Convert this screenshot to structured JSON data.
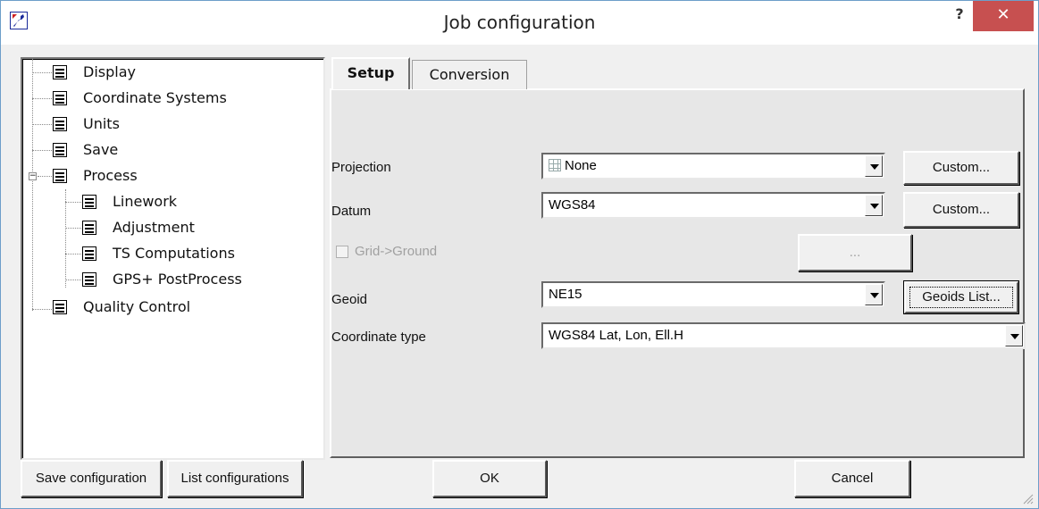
{
  "window": {
    "title": "Job configuration",
    "help_label": "?",
    "close_label": "✕",
    "app_icon": "wrench-icon"
  },
  "tree": {
    "items": [
      {
        "label": "Display"
      },
      {
        "label": "Coordinate Systems"
      },
      {
        "label": "Units"
      },
      {
        "label": "Save"
      },
      {
        "label": "Process",
        "expanded": true
      },
      {
        "label": "Linework"
      },
      {
        "label": "Adjustment"
      },
      {
        "label": "TS Computations"
      },
      {
        "label": "GPS+ PostProcess"
      },
      {
        "label": "Quality Control"
      }
    ],
    "expander_symbol": "−"
  },
  "tabs": [
    {
      "label": "Setup",
      "active": true
    },
    {
      "label": "Conversion",
      "active": false
    }
  ],
  "setup": {
    "projection": {
      "label": "Projection",
      "value": "None",
      "icon": "grid-icon",
      "button": "Custom..."
    },
    "datum": {
      "label": "Datum",
      "value": "WGS84",
      "button": "Custom..."
    },
    "grid_ground": {
      "label": "Grid->Ground",
      "checked": false,
      "enabled": false,
      "button": "..."
    },
    "geoid": {
      "label": "Geoid",
      "value": "NE15",
      "button": "Geoids List..."
    },
    "coordinate_type": {
      "label": "Coordinate type",
      "value": "WGS84 Lat, Lon, Ell.H"
    }
  },
  "footer": {
    "save_config": "Save configuration",
    "list_configs": "List configurations",
    "ok": "OK",
    "cancel": "Cancel"
  }
}
